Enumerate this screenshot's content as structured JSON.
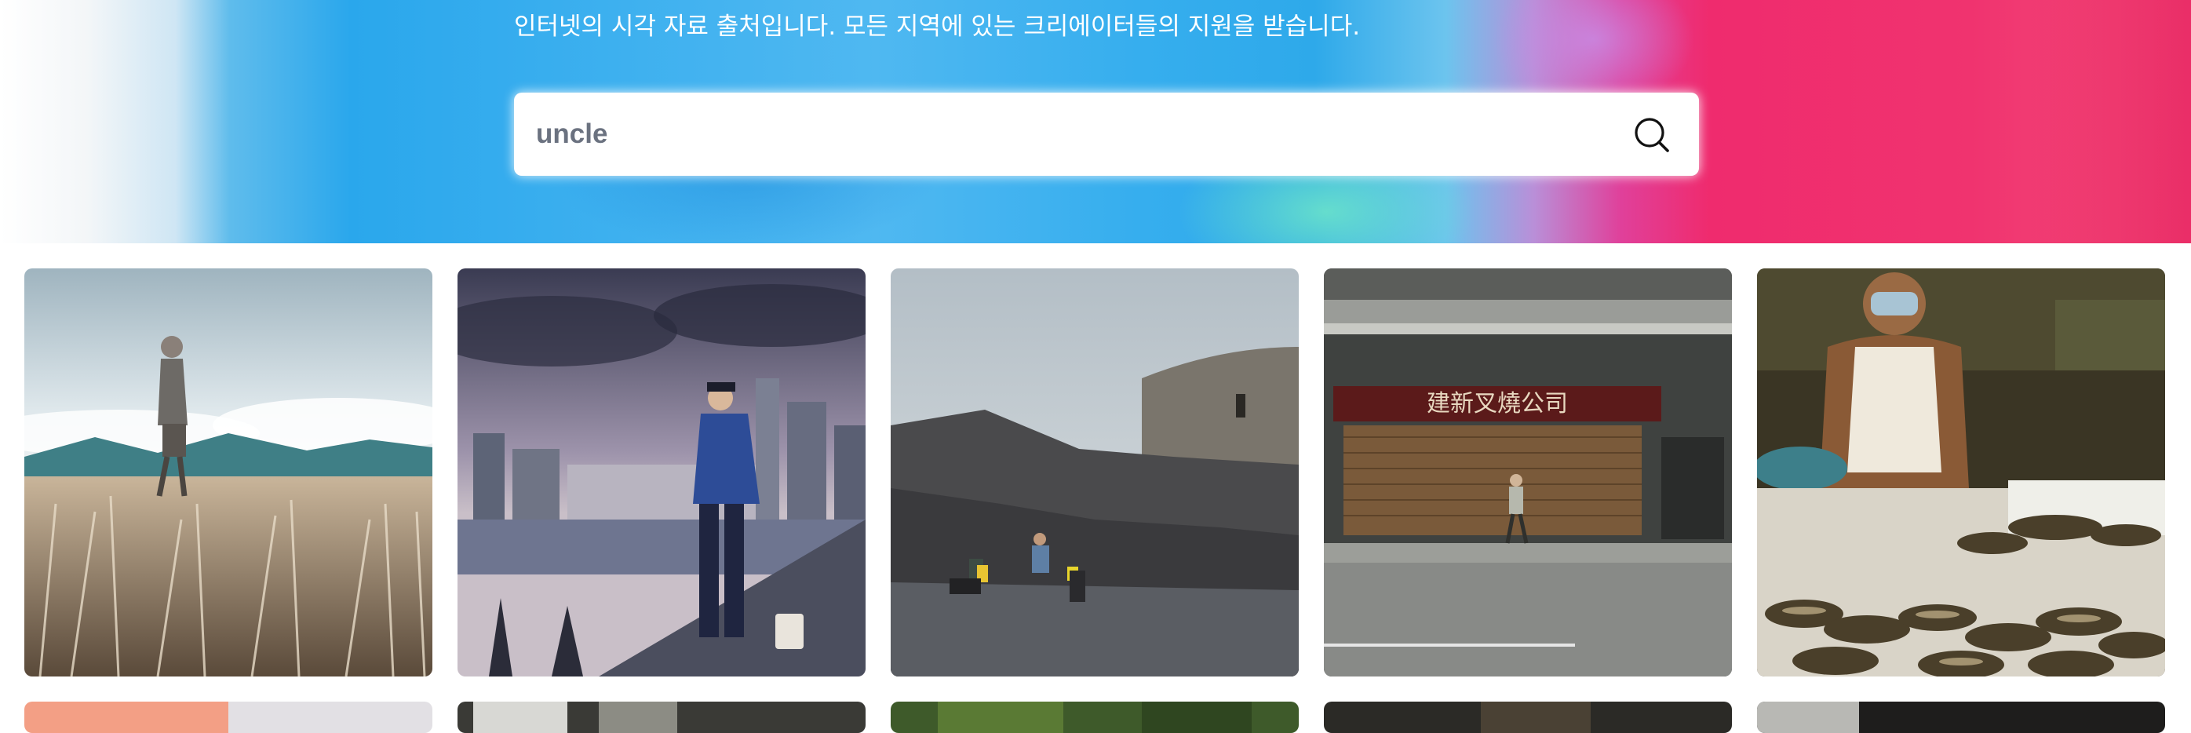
{
  "hero": {
    "tagline": "인터넷의 시각 자료 출처입니다. 모든 지역에 있는 크리에이터들의 지원을 받습니다."
  },
  "search": {
    "value": "uncle",
    "icon": "search-icon"
  },
  "photos": [
    {
      "label": "",
      "sign_text": ""
    },
    {
      "label": "",
      "sign_text": ""
    },
    {
      "label": "",
      "sign_text": ""
    },
    {
      "label": "",
      "sign_text": "建新叉燒公司"
    },
    {
      "label": "",
      "sign_text": ""
    }
  ],
  "colors": {
    "hero_blue": "#2aa7ec",
    "hero_pink": "#f0336f",
    "search_text": "#6b7280"
  }
}
